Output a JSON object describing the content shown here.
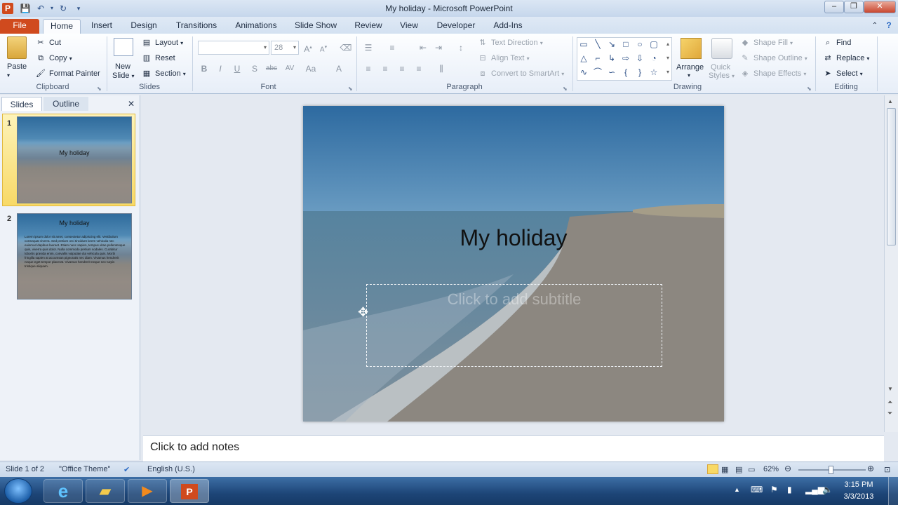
{
  "window": {
    "title": "My holiday  -  Microsoft PowerPoint",
    "app_icon": "P",
    "controls": [
      "–",
      "❐",
      "✕"
    ]
  },
  "tabs": [
    "File",
    "Home",
    "Insert",
    "Design",
    "Transitions",
    "Animations",
    "Slide Show",
    "Review",
    "View",
    "Developer",
    "Add-Ins"
  ],
  "ribbon": {
    "clipboard": {
      "label": "Clipboard",
      "paste": "Paste",
      "cut": "Cut",
      "copy": "Copy",
      "format_painter": "Format Painter"
    },
    "slides": {
      "label": "Slides",
      "new_slide_line1": "New",
      "new_slide_line2": "Slide",
      "layout": "Layout",
      "reset": "Reset",
      "section": "Section"
    },
    "font": {
      "label": "Font",
      "font_name": "",
      "font_size": "28",
      "bold": "B",
      "italic": "I",
      "underline": "U",
      "shadow": "S",
      "strike": "abc"
    },
    "paragraph": {
      "label": "Paragraph",
      "text_direction": "Text Direction",
      "align_text": "Align Text",
      "convert_smartart": "Convert to SmartArt"
    },
    "drawing": {
      "label": "Drawing",
      "arrange": "Arrange",
      "quick_line1": "Quick",
      "quick_line2": "Styles",
      "shape_fill": "Shape Fill",
      "shape_outline": "Shape Outline",
      "shape_effects": "Shape Effects"
    },
    "editing": {
      "label": "Editing",
      "find": "Find",
      "replace": "Replace",
      "select": "Select"
    }
  },
  "left_pane": {
    "tab_slides": "Slides",
    "tab_outline": "Outline",
    "close": "✕",
    "thumbs": [
      {
        "num": "1",
        "title": "My holiday",
        "body": ""
      },
      {
        "num": "2",
        "title": "My holiday",
        "body": "Lorem ipsum dolor sit amet, consectetur adipiscing elit. Vestibulum consequat viverra. Sed pretium orci tincidunt lorem vehicula nec euismod dapibus laoreet. Etiam nunc sapien, tempus vitae pellentesque quis, viverra quis dolor. Nulla commodo pretium sodales. Curabitur lobortis gravida enim, convallis vulputate dui vehicula quis. Morbi fringilla sapien at accumsan pignoratis nec diam. Vivamus hendrerit neque eget tempor placerat. Vivamus hendrerit neque nec turpis tristique aliquam."
      }
    ]
  },
  "slide": {
    "title": "My holiday",
    "subtitle_placeholder": "Click to add subtitle"
  },
  "notes": {
    "placeholder": "Click to add notes"
  },
  "status_bar": {
    "slide_info": "Slide 1 of 2",
    "theme": "\"Office Theme\"",
    "language": "English (U.S.)",
    "zoom": "62%",
    "zoom_fraction": 0.48
  },
  "taskbar": {
    "time": "3:15 PM",
    "date": "3/3/2013"
  }
}
